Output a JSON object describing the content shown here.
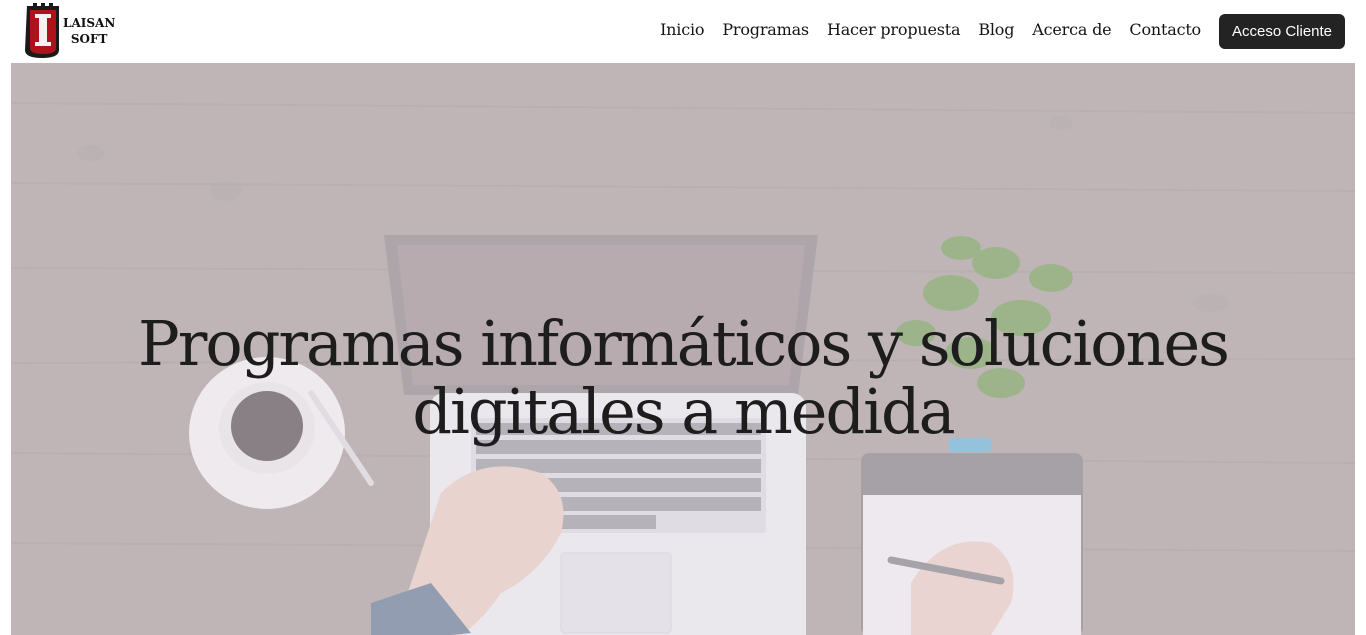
{
  "brand": {
    "logo_mark": "I",
    "logo_line1": "LAISAN",
    "logo_line2": "SOFT",
    "shield_color": "#b0121c"
  },
  "nav": {
    "items": [
      {
        "label": "Inicio"
      },
      {
        "label": "Programas"
      },
      {
        "label": "Hacer propuesta"
      },
      {
        "label": "Blog"
      },
      {
        "label": "Acerca de"
      },
      {
        "label": "Contacto"
      }
    ],
    "cta_label": "Acceso Cliente"
  },
  "hero": {
    "title": "Programas informáticos y soluciones digitales a medida",
    "image_subject": "laptop-desk-photo"
  },
  "colors": {
    "cta_bg": "#232323",
    "cta_text": "#ffffff",
    "title": "#1d1d1d"
  }
}
